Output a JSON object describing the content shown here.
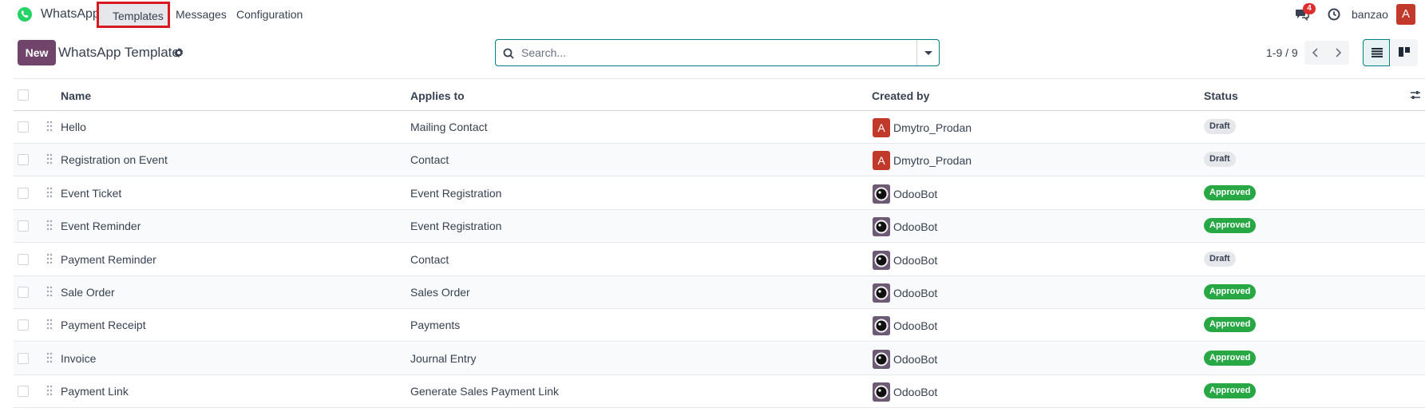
{
  "navbar": {
    "app_name": "WhatsApp",
    "menu": [
      "Templates",
      "Messages",
      "Configuration"
    ],
    "messages_badge": "4",
    "user_name": "banzao",
    "user_initial": "A"
  },
  "control_panel": {
    "new_label": "New",
    "title": "WhatsApp Template",
    "search_placeholder": "Search...",
    "pager": "1-9 / 9"
  },
  "table": {
    "columns": [
      "Name",
      "Applies to",
      "Created by",
      "Status"
    ],
    "rows": [
      {
        "name": "Hello",
        "applies_to": "Mailing Contact",
        "created_by": "Dmytro_Prodan",
        "avatar": "A",
        "status": "Draft"
      },
      {
        "name": "Registration on Event",
        "applies_to": "Contact",
        "created_by": "Dmytro_Prodan",
        "avatar": "A",
        "status": "Draft"
      },
      {
        "name": "Event Ticket",
        "applies_to": "Event Registration",
        "created_by": "OdooBot",
        "avatar": "bot",
        "status": "Approved"
      },
      {
        "name": "Event Reminder",
        "applies_to": "Event Registration",
        "created_by": "OdooBot",
        "avatar": "bot",
        "status": "Approved"
      },
      {
        "name": "Payment Reminder",
        "applies_to": "Contact",
        "created_by": "OdooBot",
        "avatar": "bot",
        "status": "Draft"
      },
      {
        "name": "Sale Order",
        "applies_to": "Sales Order",
        "created_by": "OdooBot",
        "avatar": "bot",
        "status": "Approved"
      },
      {
        "name": "Payment Receipt",
        "applies_to": "Payments",
        "created_by": "OdooBot",
        "avatar": "bot",
        "status": "Approved"
      },
      {
        "name": "Invoice",
        "applies_to": "Journal Entry",
        "created_by": "OdooBot",
        "avatar": "bot",
        "status": "Approved"
      },
      {
        "name": "Payment Link",
        "applies_to": "Generate Sales Payment Link",
        "created_by": "OdooBot",
        "avatar": "bot",
        "status": "Approved"
      }
    ]
  },
  "colors": {
    "brand": "#71456b",
    "accent": "#017e84",
    "approved": "#28a745",
    "highlight": "#d71920"
  }
}
